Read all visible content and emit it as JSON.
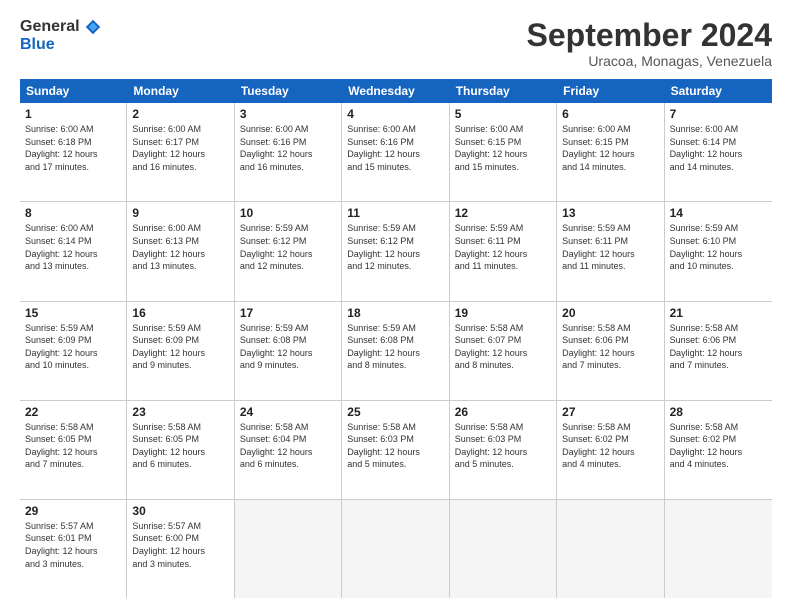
{
  "logo": {
    "general": "General",
    "blue": "Blue"
  },
  "title": "September 2024",
  "location": "Uracoa, Monagas, Venezuela",
  "header_days": [
    "Sunday",
    "Monday",
    "Tuesday",
    "Wednesday",
    "Thursday",
    "Friday",
    "Saturday"
  ],
  "rows": [
    [
      {
        "day": "1",
        "lines": [
          "Sunrise: 6:00 AM",
          "Sunset: 6:18 PM",
          "Daylight: 12 hours",
          "and 17 minutes."
        ]
      },
      {
        "day": "2",
        "lines": [
          "Sunrise: 6:00 AM",
          "Sunset: 6:17 PM",
          "Daylight: 12 hours",
          "and 16 minutes."
        ]
      },
      {
        "day": "3",
        "lines": [
          "Sunrise: 6:00 AM",
          "Sunset: 6:16 PM",
          "Daylight: 12 hours",
          "and 16 minutes."
        ]
      },
      {
        "day": "4",
        "lines": [
          "Sunrise: 6:00 AM",
          "Sunset: 6:16 PM",
          "Daylight: 12 hours",
          "and 15 minutes."
        ]
      },
      {
        "day": "5",
        "lines": [
          "Sunrise: 6:00 AM",
          "Sunset: 6:15 PM",
          "Daylight: 12 hours",
          "and 15 minutes."
        ]
      },
      {
        "day": "6",
        "lines": [
          "Sunrise: 6:00 AM",
          "Sunset: 6:15 PM",
          "Daylight: 12 hours",
          "and 14 minutes."
        ]
      },
      {
        "day": "7",
        "lines": [
          "Sunrise: 6:00 AM",
          "Sunset: 6:14 PM",
          "Daylight: 12 hours",
          "and 14 minutes."
        ]
      }
    ],
    [
      {
        "day": "8",
        "lines": [
          "Sunrise: 6:00 AM",
          "Sunset: 6:14 PM",
          "Daylight: 12 hours",
          "and 13 minutes."
        ]
      },
      {
        "day": "9",
        "lines": [
          "Sunrise: 6:00 AM",
          "Sunset: 6:13 PM",
          "Daylight: 12 hours",
          "and 13 minutes."
        ]
      },
      {
        "day": "10",
        "lines": [
          "Sunrise: 5:59 AM",
          "Sunset: 6:12 PM",
          "Daylight: 12 hours",
          "and 12 minutes."
        ]
      },
      {
        "day": "11",
        "lines": [
          "Sunrise: 5:59 AM",
          "Sunset: 6:12 PM",
          "Daylight: 12 hours",
          "and 12 minutes."
        ]
      },
      {
        "day": "12",
        "lines": [
          "Sunrise: 5:59 AM",
          "Sunset: 6:11 PM",
          "Daylight: 12 hours",
          "and 11 minutes."
        ]
      },
      {
        "day": "13",
        "lines": [
          "Sunrise: 5:59 AM",
          "Sunset: 6:11 PM",
          "Daylight: 12 hours",
          "and 11 minutes."
        ]
      },
      {
        "day": "14",
        "lines": [
          "Sunrise: 5:59 AM",
          "Sunset: 6:10 PM",
          "Daylight: 12 hours",
          "and 10 minutes."
        ]
      }
    ],
    [
      {
        "day": "15",
        "lines": [
          "Sunrise: 5:59 AM",
          "Sunset: 6:09 PM",
          "Daylight: 12 hours",
          "and 10 minutes."
        ]
      },
      {
        "day": "16",
        "lines": [
          "Sunrise: 5:59 AM",
          "Sunset: 6:09 PM",
          "Daylight: 12 hours",
          "and 9 minutes."
        ]
      },
      {
        "day": "17",
        "lines": [
          "Sunrise: 5:59 AM",
          "Sunset: 6:08 PM",
          "Daylight: 12 hours",
          "and 9 minutes."
        ]
      },
      {
        "day": "18",
        "lines": [
          "Sunrise: 5:59 AM",
          "Sunset: 6:08 PM",
          "Daylight: 12 hours",
          "and 8 minutes."
        ]
      },
      {
        "day": "19",
        "lines": [
          "Sunrise: 5:58 AM",
          "Sunset: 6:07 PM",
          "Daylight: 12 hours",
          "and 8 minutes."
        ]
      },
      {
        "day": "20",
        "lines": [
          "Sunrise: 5:58 AM",
          "Sunset: 6:06 PM",
          "Daylight: 12 hours",
          "and 7 minutes."
        ]
      },
      {
        "day": "21",
        "lines": [
          "Sunrise: 5:58 AM",
          "Sunset: 6:06 PM",
          "Daylight: 12 hours",
          "and 7 minutes."
        ]
      }
    ],
    [
      {
        "day": "22",
        "lines": [
          "Sunrise: 5:58 AM",
          "Sunset: 6:05 PM",
          "Daylight: 12 hours",
          "and 7 minutes."
        ]
      },
      {
        "day": "23",
        "lines": [
          "Sunrise: 5:58 AM",
          "Sunset: 6:05 PM",
          "Daylight: 12 hours",
          "and 6 minutes."
        ]
      },
      {
        "day": "24",
        "lines": [
          "Sunrise: 5:58 AM",
          "Sunset: 6:04 PM",
          "Daylight: 12 hours",
          "and 6 minutes."
        ]
      },
      {
        "day": "25",
        "lines": [
          "Sunrise: 5:58 AM",
          "Sunset: 6:03 PM",
          "Daylight: 12 hours",
          "and 5 minutes."
        ]
      },
      {
        "day": "26",
        "lines": [
          "Sunrise: 5:58 AM",
          "Sunset: 6:03 PM",
          "Daylight: 12 hours",
          "and 5 minutes."
        ]
      },
      {
        "day": "27",
        "lines": [
          "Sunrise: 5:58 AM",
          "Sunset: 6:02 PM",
          "Daylight: 12 hours",
          "and 4 minutes."
        ]
      },
      {
        "day": "28",
        "lines": [
          "Sunrise: 5:58 AM",
          "Sunset: 6:02 PM",
          "Daylight: 12 hours",
          "and 4 minutes."
        ]
      }
    ],
    [
      {
        "day": "29",
        "lines": [
          "Sunrise: 5:57 AM",
          "Sunset: 6:01 PM",
          "Daylight: 12 hours",
          "and 3 minutes."
        ]
      },
      {
        "day": "30",
        "lines": [
          "Sunrise: 5:57 AM",
          "Sunset: 6:00 PM",
          "Daylight: 12 hours",
          "and 3 minutes."
        ]
      },
      {
        "day": "",
        "lines": []
      },
      {
        "day": "",
        "lines": []
      },
      {
        "day": "",
        "lines": []
      },
      {
        "day": "",
        "lines": []
      },
      {
        "day": "",
        "lines": []
      }
    ]
  ]
}
